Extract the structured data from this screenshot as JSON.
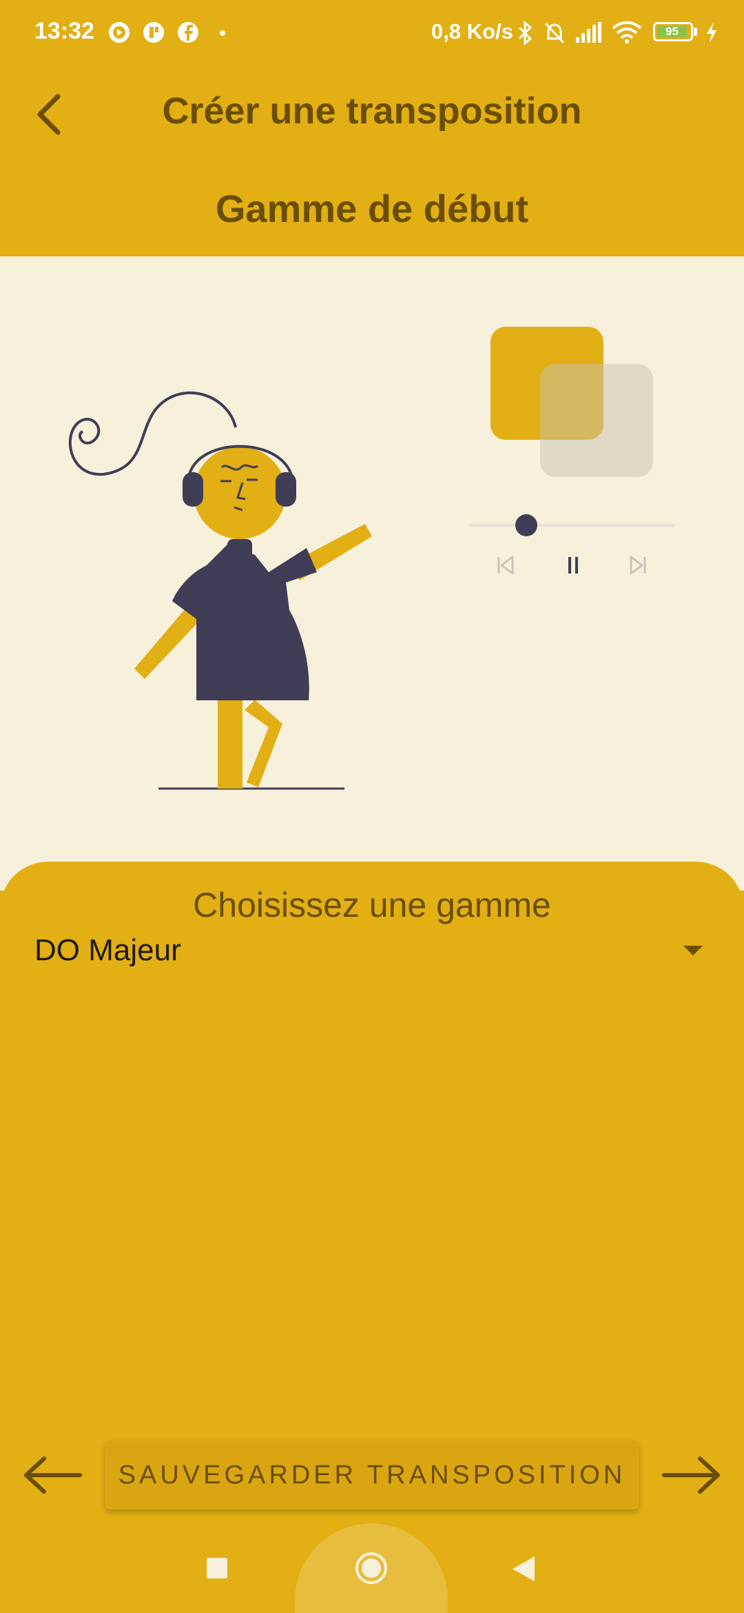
{
  "status_bar": {
    "time": "13:32",
    "network_speed": "0,8 Ko/s",
    "battery": "95",
    "icons": [
      "record-icon",
      "app-icon",
      "facebook-icon",
      "dot-icon",
      "bluetooth-icon",
      "mute-icon",
      "signal-icon",
      "wifi-icon",
      "battery-icon",
      "charging-icon"
    ]
  },
  "header": {
    "title": "Créer une transposition",
    "section_title": "Gamme de début",
    "back_icon": "chevron-left-icon"
  },
  "player": {
    "progress": 0.28,
    "controls": [
      "skip-previous-icon",
      "pause-icon",
      "skip-next-icon"
    ]
  },
  "picker": {
    "label": "Choisissez une gamme",
    "selected": "DO Majeur"
  },
  "footer": {
    "save_label": "SAUVEGARDER TRANSPOSITION",
    "prev_icon": "arrow-left-icon",
    "next_icon": "arrow-right-icon"
  },
  "colors": {
    "primary": "#e2af14",
    "accent_text": "#6b4e06",
    "panel": "#f7f1dc",
    "figure_dark": "#3f3d56"
  }
}
